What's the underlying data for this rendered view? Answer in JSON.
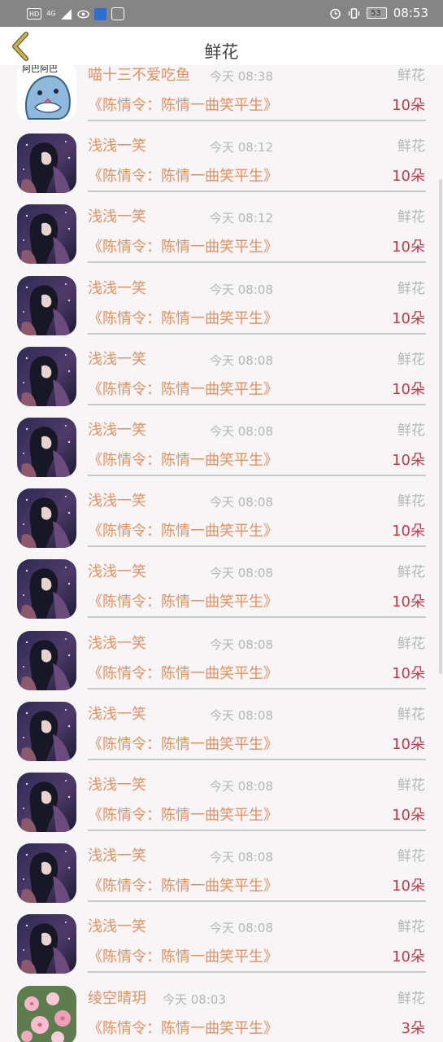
{
  "status_bar": {
    "left_indicators": [
      "HD",
      "4G"
    ],
    "time": "08:53",
    "battery": "53"
  },
  "header": {
    "title": "鲜花"
  },
  "gifts": [
    {
      "name": "喵十三不爱吃鱼",
      "time": "今天 08:38",
      "tag": "鲜花",
      "drama": "《陈情令：陈情一曲笑平生》",
      "count": "10朵",
      "avatar": "cartoon-shark"
    },
    {
      "name": "浅浅一笑",
      "time": "今天 08:12",
      "tag": "鲜花",
      "drama": "《陈情令：陈情一曲笑平生》",
      "count": "10朵",
      "avatar": "anime-night"
    },
    {
      "name": "浅浅一笑",
      "time": "今天 08:12",
      "tag": "鲜花",
      "drama": "《陈情令：陈情一曲笑平生》",
      "count": "10朵",
      "avatar": "anime-night"
    },
    {
      "name": "浅浅一笑",
      "time": "今天 08:08",
      "tag": "鲜花",
      "drama": "《陈情令：陈情一曲笑平生》",
      "count": "10朵",
      "avatar": "anime-night"
    },
    {
      "name": "浅浅一笑",
      "time": "今天 08:08",
      "tag": "鲜花",
      "drama": "《陈情令：陈情一曲笑平生》",
      "count": "10朵",
      "avatar": "anime-night"
    },
    {
      "name": "浅浅一笑",
      "time": "今天 08:08",
      "tag": "鲜花",
      "drama": "《陈情令：陈情一曲笑平生》",
      "count": "10朵",
      "avatar": "anime-night"
    },
    {
      "name": "浅浅一笑",
      "time": "今天 08:08",
      "tag": "鲜花",
      "drama": "《陈情令：陈情一曲笑平生》",
      "count": "10朵",
      "avatar": "anime-night"
    },
    {
      "name": "浅浅一笑",
      "time": "今天 08:08",
      "tag": "鲜花",
      "drama": "《陈情令：陈情一曲笑平生》",
      "count": "10朵",
      "avatar": "anime-night"
    },
    {
      "name": "浅浅一笑",
      "time": "今天 08:08",
      "tag": "鲜花",
      "drama": "《陈情令：陈情一曲笑平生》",
      "count": "10朵",
      "avatar": "anime-night"
    },
    {
      "name": "浅浅一笑",
      "time": "今天 08:08",
      "tag": "鲜花",
      "drama": "《陈情令：陈情一曲笑平生》",
      "count": "10朵",
      "avatar": "anime-night"
    },
    {
      "name": "浅浅一笑",
      "time": "今天 08:08",
      "tag": "鲜花",
      "drama": "《陈情令：陈情一曲笑平生》",
      "count": "10朵",
      "avatar": "anime-night"
    },
    {
      "name": "浅浅一笑",
      "time": "今天 08:08",
      "tag": "鲜花",
      "drama": "《陈情令：陈情一曲笑平生》",
      "count": "10朵",
      "avatar": "anime-night"
    },
    {
      "name": "浅浅一笑",
      "time": "今天 08:08",
      "tag": "鲜花",
      "drama": "《陈情令：陈情一曲笑平生》",
      "count": "10朵",
      "avatar": "anime-night"
    },
    {
      "name": "绫空晴玥",
      "time": "今天 08:03",
      "tag": "鲜花",
      "drama": "《陈情令：陈情一曲笑平生》",
      "count": "3朵",
      "avatar": "pink-flowers"
    }
  ],
  "colors": {
    "name": "#e29161",
    "count": "#c5384a",
    "muted": "#b6b6b6",
    "back_arrow": "#c9b34a",
    "background": "#f7f5f6"
  }
}
